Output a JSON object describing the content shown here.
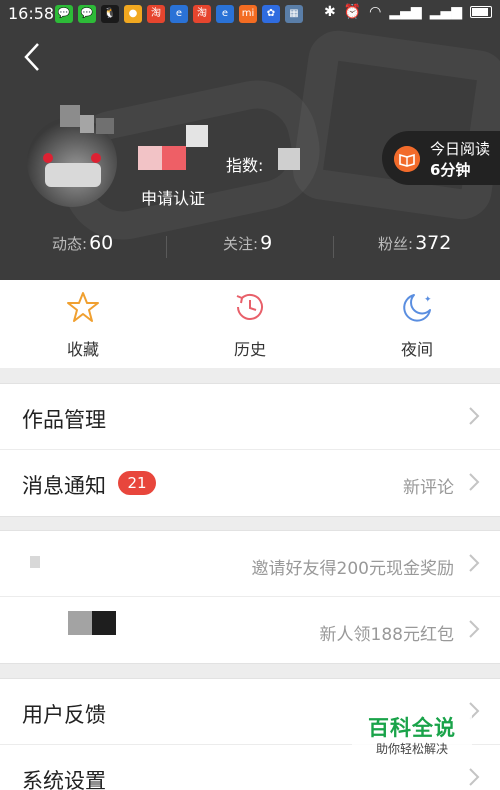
{
  "status_bar": {
    "time": "16:58",
    "app_icons": [
      {
        "name": "wechat-icon",
        "color": "#2dbb38",
        "glyph": "💬"
      },
      {
        "name": "wechat-icon",
        "color": "#2dbb38",
        "glyph": "💬"
      },
      {
        "name": "qq-icon",
        "color": "#1a1a1a",
        "glyph": "🐧"
      },
      {
        "name": "message-icon",
        "color": "#f1a820",
        "glyph": "●"
      },
      {
        "name": "taobao-icon",
        "color": "#e6452e",
        "glyph": "淘"
      },
      {
        "name": "browser-icon",
        "color": "#2a72d6",
        "glyph": "e"
      },
      {
        "name": "taobao-icon",
        "color": "#e6452e",
        "glyph": "淘"
      },
      {
        "name": "browser-icon",
        "color": "#2a72d6",
        "glyph": "e"
      },
      {
        "name": "mi-icon",
        "color": "#f36c22",
        "glyph": "mi"
      },
      {
        "name": "baidu-icon",
        "color": "#2f6ce0",
        "glyph": "✿"
      },
      {
        "name": "app-icon",
        "color": "#5a7ea8",
        "glyph": "▦"
      }
    ]
  },
  "profile": {
    "apply_verify": "申请认证",
    "index_label": "指数:",
    "reading_today_label": "今日阅读",
    "reading_today_value": "6分钟"
  },
  "stats": [
    {
      "label": "动态:",
      "value": "60"
    },
    {
      "label": "关注:",
      "value": "9"
    },
    {
      "label": "粉丝:",
      "value": "372"
    }
  ],
  "quick_actions": [
    {
      "label": "收藏",
      "icon": "star-icon"
    },
    {
      "label": "历史",
      "icon": "clock-icon"
    },
    {
      "label": "夜间",
      "icon": "moon-icon"
    }
  ],
  "menu_groups": {
    "group1": [
      {
        "label": "作品管理",
        "hint": ""
      },
      {
        "label": "消息通知",
        "badge": "21",
        "hint": "新评论"
      }
    ],
    "group2": [
      {
        "label": "",
        "hint": "邀请好友得200元现金奖励"
      },
      {
        "label": "",
        "hint": "新人领188元红包"
      }
    ],
    "group3": [
      {
        "label": "用户反馈",
        "hint": ""
      },
      {
        "label": "系统设置",
        "hint": ""
      }
    ]
  },
  "watermark": {
    "title": "百科全说",
    "subtitle": "助你轻松解决"
  },
  "colors": {
    "header_bg": "#3c3c3c",
    "badge_red": "#e8463c",
    "reading_orange": "#f26b2b",
    "star_orange": "#f0a030",
    "clock_red": "#e8606a",
    "moon_blue": "#5a8ee0"
  }
}
